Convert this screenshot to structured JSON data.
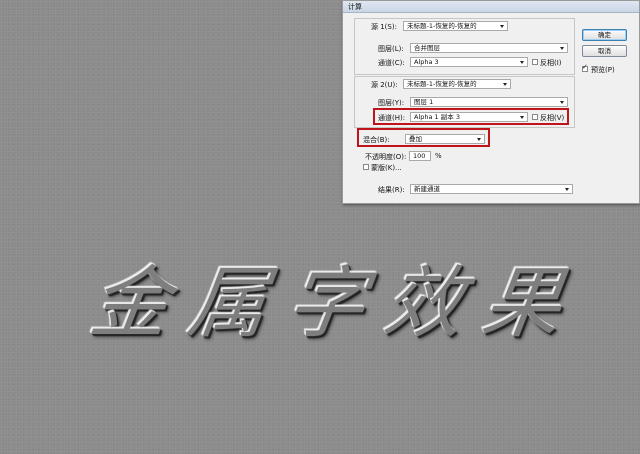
{
  "dialog": {
    "title": "计算",
    "source1": {
      "label": "源 1(S):",
      "value": "未标题-1-恢复的-恢复的",
      "layer_label": "图层(L):",
      "layer_value": "合并图层",
      "channel_label": "通道(C):",
      "channel_value": "Alpha 3",
      "invert_label": "反相(I)",
      "invert_checked": false
    },
    "source2": {
      "label": "源 2(U):",
      "value": "未标题-1-恢复的-恢复的",
      "layer_label": "图层(Y):",
      "layer_value": "图层 1",
      "channel_label": "通道(H):",
      "channel_value": "Alpha 1 副本 3",
      "invert_label": "反相(V)",
      "invert_checked": false
    },
    "blending": {
      "label": "混合(B):",
      "value": "叠加",
      "opacity_label": "不透明度(O):",
      "opacity_value": "100",
      "opacity_unit": "%",
      "mask_label": "蒙版(K)...",
      "mask_checked": false
    },
    "result": {
      "label": "结果(R):",
      "value": "新建通道"
    },
    "buttons": {
      "ok": "确定",
      "cancel": "取消"
    },
    "preview": {
      "label": "预览(P)",
      "checked": true
    }
  },
  "canvas": {
    "artwork_text": [
      "金",
      "属",
      "字",
      "效",
      "果"
    ]
  },
  "colors": {
    "canvas_gray": "#8c8c8c",
    "highlight_red": "#c0141c",
    "dialog_bg": "#f0f0f0"
  }
}
